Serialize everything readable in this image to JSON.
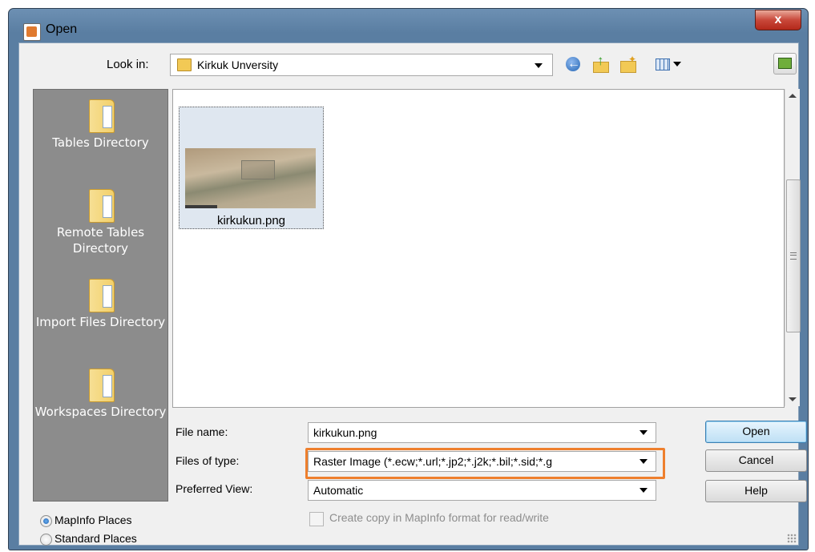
{
  "window": {
    "title": "Open",
    "close_label": "x"
  },
  "toolbar": {
    "look_in_label": "Look in:",
    "look_in_value": "Kirkuk Unversity",
    "icons": [
      "back-icon",
      "up-folder-icon",
      "new-folder-icon",
      "views-menu-icon",
      "desktop-icon"
    ]
  },
  "places": [
    {
      "label": "Tables Directory"
    },
    {
      "label": "Remote Tables Directory"
    },
    {
      "label": "Import Files Directory"
    },
    {
      "label": "Workspaces Directory"
    }
  ],
  "files": [
    {
      "name": "kirkukun.png",
      "type": "image-thumbnail"
    }
  ],
  "form": {
    "file_name_label": "File name:",
    "file_name_value": "kirkukun.png",
    "files_of_type_label": "Files of type:",
    "files_of_type_value": "Raster Image (*.ecw;*.url;*.jp2;*.j2k;*.bil;*.sid;*.g",
    "preferred_view_label": "Preferred View:",
    "preferred_view_value": "Automatic",
    "copy_checkbox_label": "Create copy in MapInfo format for read/write",
    "copy_checkbox_checked": false
  },
  "buttons": {
    "open": "Open",
    "cancel": "Cancel",
    "help": "Help"
  },
  "places_radio": {
    "options": [
      "MapInfo Places",
      "Standard Places"
    ],
    "selected": "MapInfo Places"
  },
  "colors": {
    "highlight_box": "#ee7f2d",
    "title_bar": "#5a7ea2",
    "places_panel": "#8c8c8c"
  }
}
